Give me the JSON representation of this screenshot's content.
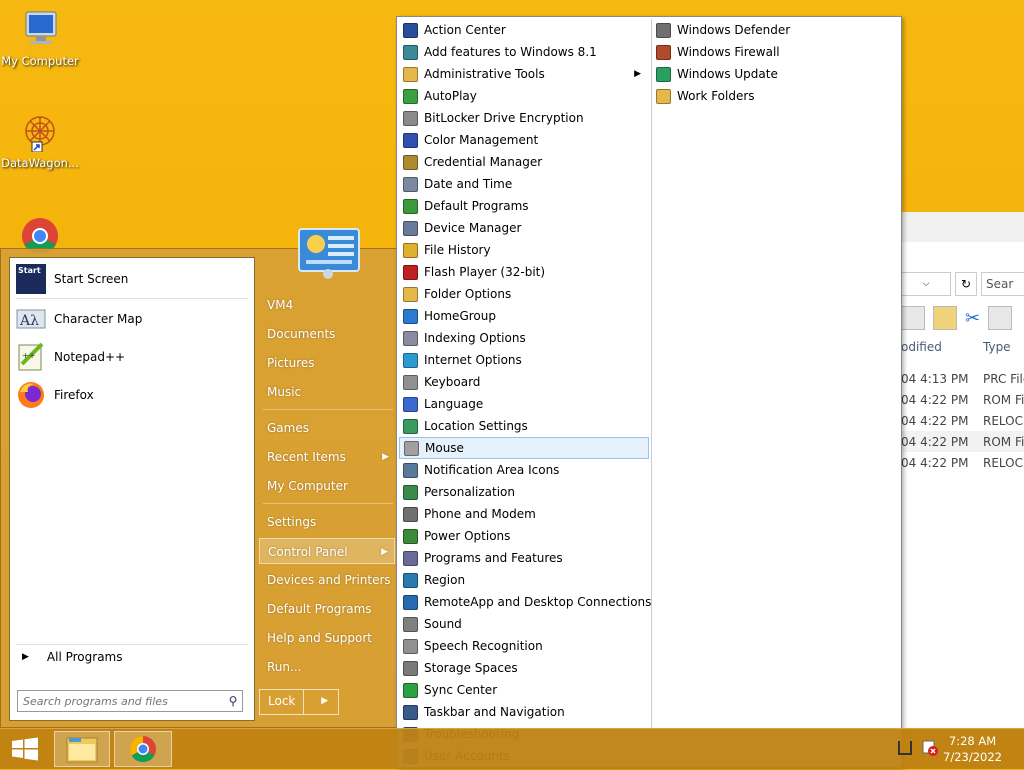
{
  "desktop": {
    "icons": [
      {
        "label": "My Computer",
        "icon": "monitor-icon"
      },
      {
        "label": "DataWagon...",
        "icon": "datawagon-shortcut-icon"
      },
      {
        "label": "",
        "icon": "chrome-icon"
      }
    ]
  },
  "explorer": {
    "search_placeholder": "Sear",
    "columns": [
      "odified",
      "Type"
    ],
    "rows": [
      {
        "modified": "04 4:13 PM",
        "type": "PRC File"
      },
      {
        "modified": "04 4:22 PM",
        "type": "ROM File"
      },
      {
        "modified": "04 4:22 PM",
        "type": "RELOC F"
      },
      {
        "modified": "04 4:22 PM",
        "type": "ROM File"
      },
      {
        "modified": "04 4:22 PM",
        "type": "RELOC F"
      }
    ]
  },
  "start_menu": {
    "pinned": [
      {
        "label": "Start Screen",
        "badge": "Start"
      },
      {
        "label": "Character Map"
      },
      {
        "label": "Notepad++"
      },
      {
        "label": "Firefox"
      }
    ],
    "all_programs": "All Programs",
    "search_placeholder": "Search programs and files",
    "right": [
      {
        "label": "VM4"
      },
      {
        "label": "Documents"
      },
      {
        "label": "Pictures"
      },
      {
        "label": "Music"
      },
      {
        "label": "Games"
      },
      {
        "label": "Recent Items"
      },
      {
        "label": "My Computer"
      },
      {
        "label": "Settings"
      },
      {
        "label": "Control Panel"
      },
      {
        "label": "Devices and Printers"
      },
      {
        "label": "Default Programs"
      },
      {
        "label": "Help and Support"
      },
      {
        "label": "Run..."
      }
    ],
    "lock_label": "Lock"
  },
  "control_panel": {
    "col1": [
      {
        "label": "Action Center",
        "color": "#2a4f9a"
      },
      {
        "label": "Add features to Windows 8.1",
        "color": "#3a8a9a"
      },
      {
        "label": "Administrative Tools",
        "color": "#e6b84a"
      },
      {
        "label": "AutoPlay",
        "color": "#3aa040"
      },
      {
        "label": "BitLocker Drive Encryption",
        "color": "#8a8a8a"
      },
      {
        "label": "Color Management",
        "color": "#3050b0"
      },
      {
        "label": "Credential Manager",
        "color": "#b08a30"
      },
      {
        "label": "Date and Time",
        "color": "#7a8aa0"
      },
      {
        "label": "Default Programs",
        "color": "#3a9a3a"
      },
      {
        "label": "Device Manager",
        "color": "#6a7a9a"
      },
      {
        "label": "File History",
        "color": "#e0b030"
      },
      {
        "label": "Flash Player (32-bit)",
        "color": "#c02020"
      },
      {
        "label": "Folder Options",
        "color": "#e6b84a"
      },
      {
        "label": "HomeGroup",
        "color": "#2a7ad0"
      },
      {
        "label": "Indexing Options",
        "color": "#8a8aa0"
      },
      {
        "label": "Internet Options",
        "color": "#2a9ad0"
      },
      {
        "label": "Keyboard",
        "color": "#909090"
      },
      {
        "label": "Language",
        "color": "#3a6ad0"
      },
      {
        "label": "Location Settings",
        "color": "#3a9a60"
      },
      {
        "label": "Mouse",
        "color": "#a0a0a0"
      },
      {
        "label": "Notification Area Icons",
        "color": "#5a7a9a"
      },
      {
        "label": "Personalization",
        "color": "#3a8a4a"
      },
      {
        "label": "Phone and Modem",
        "color": "#707070"
      },
      {
        "label": "Power Options",
        "color": "#3a8a3a"
      },
      {
        "label": "Programs and Features",
        "color": "#6a6a9a"
      },
      {
        "label": "Region",
        "color": "#2a7ab0"
      },
      {
        "label": "RemoteApp and Desktop Connections",
        "color": "#2a6ab0"
      },
      {
        "label": "Sound",
        "color": "#808080"
      },
      {
        "label": "Speech Recognition",
        "color": "#909090"
      },
      {
        "label": "Storage Spaces",
        "color": "#7a7a7a"
      },
      {
        "label": "Sync Center",
        "color": "#2aa040"
      },
      {
        "label": "Taskbar and Navigation",
        "color": "#3a5a8a"
      },
      {
        "label": "Troubleshooting",
        "color": "#3a6ab0"
      },
      {
        "label": "User Accounts",
        "color": "#4a7ab0"
      }
    ],
    "col2": [
      {
        "label": "Windows Defender",
        "color": "#707070"
      },
      {
        "label": "Windows Firewall",
        "color": "#b04a2a"
      },
      {
        "label": "Windows Update",
        "color": "#2aa060"
      },
      {
        "label": "Work Folders",
        "color": "#e6b84a"
      }
    ],
    "highlighted": "Mouse",
    "submenu_item": "Administrative Tools"
  },
  "taskbar": {
    "buttons": [
      "windows-start-icon",
      "file-explorer-icon",
      "chrome-icon"
    ],
    "time": "7:28 AM",
    "date": "7/23/2022"
  }
}
